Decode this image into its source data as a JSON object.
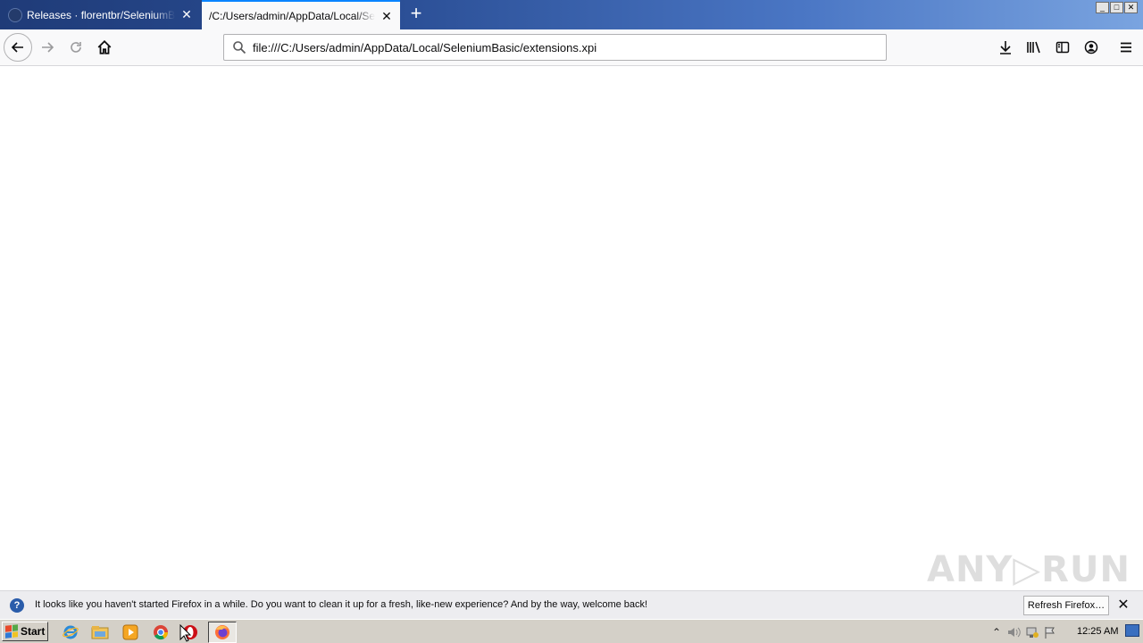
{
  "tabs": [
    {
      "title": "Releases · florentbr/SeleniumBasic",
      "favicon": "github-icon",
      "active": false
    },
    {
      "title": "/C:/Users/admin/AppData/Local/SeleniumBasic/extensions.xpi",
      "active": true
    }
  ],
  "window_controls": {
    "minimize": "_",
    "maximize": "□",
    "close": "✕"
  },
  "navbar": {
    "url": "file:///C:/Users/admin/AppData/Local/SeleniumBasic/extensions.xpi",
    "buttons": [
      "back-icon",
      "forward-icon",
      "reload-icon",
      "home-icon"
    ],
    "toolbar_icons": [
      "download-icon",
      "library-icon",
      "sidebar-icon",
      "account-icon",
      "menu-icon"
    ]
  },
  "watermark": "ANY▷RUN",
  "notification": {
    "message": "It looks like you haven't started Firefox in a while. Do you want to clean it up for a fresh, like-new experience? And by the way, welcome back!",
    "button": "Refresh Firefox…",
    "close": "✕"
  },
  "taskbar": {
    "start_label": "Start",
    "pinned": [
      "ie-icon",
      "explorer-icon",
      "media-player-icon",
      "chrome-icon",
      "opera-icon",
      "firefox-icon"
    ],
    "tray_icons": [
      "chevron-up-icon",
      "volume-icon",
      "network-icon",
      "flag-icon"
    ],
    "clock": "12:25 AM"
  },
  "colors": {
    "accent": "#0a84ff",
    "titlebar": "#2b4f96"
  }
}
